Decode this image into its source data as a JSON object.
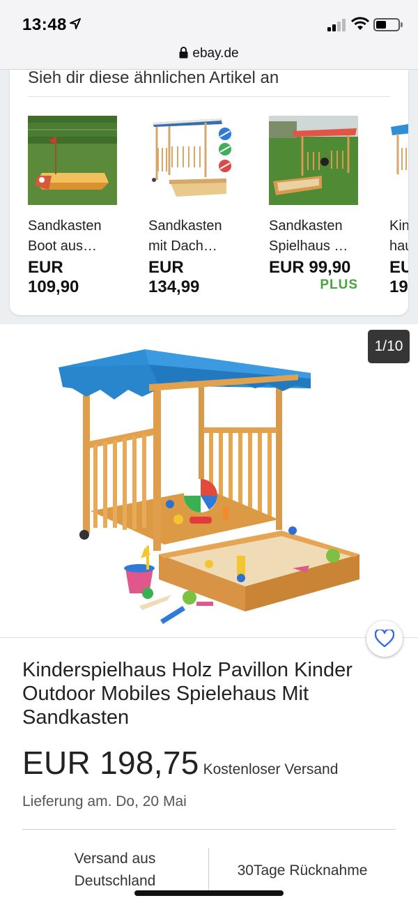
{
  "status": {
    "time": "13:48"
  },
  "browser": {
    "url": "ebay.de"
  },
  "similar": {
    "title": "Sieh dir diese ähnlichen Artikel an",
    "items": [
      {
        "title": "Sandkasten\nBoot aus…",
        "price": "EUR\n109,90"
      },
      {
        "title": "Sandkasten\nmit Dach…",
        "price": "EUR\n134,99"
      },
      {
        "title": "Sandkasten\nSpielhaus …",
        "price": "EUR 99,90",
        "badge": "PLUS"
      },
      {
        "title": "Kin\nhau",
        "price": "EU\n19"
      }
    ]
  },
  "gallery": {
    "counter": "1/10"
  },
  "product": {
    "title": " Kinderspielhaus Holz Pavillon Kinder Outdoor Mobiles Spielehaus Mit Sandkasten",
    "price": "EUR 198,75",
    "shipping": "Kostenloser Versand",
    "delivery": "Lieferung am. Do, 20 Mai",
    "info_left": "Versand aus\nDeutschland",
    "info_right": "30Tage Rücknahme"
  },
  "colors": {
    "plus_green": "#48a23f",
    "counter_bg": "#363636",
    "canopy_blue": "#2f8fd6",
    "wood": "#e2a14d",
    "heart_blue": "#3665f3"
  }
}
